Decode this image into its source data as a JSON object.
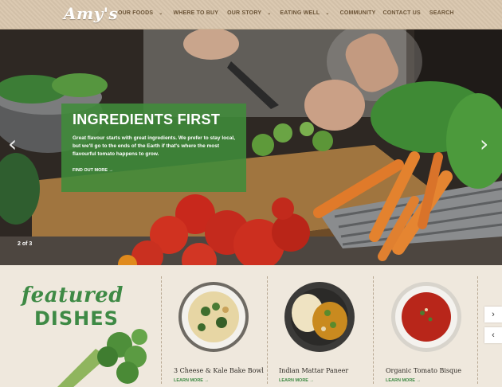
{
  "header": {
    "logo": "Amy's",
    "nav": [
      {
        "label": "OUR FOODS",
        "dropdown": true
      },
      {
        "label": "WHERE TO BUY",
        "dropdown": false
      },
      {
        "label": "OUR STORY",
        "dropdown": true
      },
      {
        "label": "EATING WELL",
        "dropdown": true
      },
      {
        "label": "COMMUNITY",
        "dropdown": false
      },
      {
        "label": "CONTACT US",
        "dropdown": false
      },
      {
        "label": "SEARCH",
        "dropdown": false
      }
    ]
  },
  "hero": {
    "title": "INGREDIENTS FIRST",
    "body": "Great flavour starts with great ingredients. We prefer to stay local, but we'll go to the ends of the Earth if that's where the most flavourful tomato happens to grow.",
    "link": "FIND OUT MORE →",
    "counter": "2 of 3",
    "prev_icon": "‹",
    "next_icon": "›"
  },
  "featured": {
    "title_line1": "featured",
    "title_line2": "DISHES",
    "dishes": [
      {
        "name": "3 Cheese & Kale Bake Bowl",
        "link": "LEARN MORE →"
      },
      {
        "name": "Indian Mattar Paneer",
        "link": "LEARN MORE →"
      },
      {
        "name": "Organic Tomato Bisque",
        "link": "LEARN MORE →"
      }
    ],
    "next_icon": "›",
    "prev_icon": "‹"
  },
  "colors": {
    "header_bg": "#d9c6ad",
    "nav_text": "#6b5437",
    "caption_green": "#408c3a",
    "brand_green": "#3e8a45"
  }
}
